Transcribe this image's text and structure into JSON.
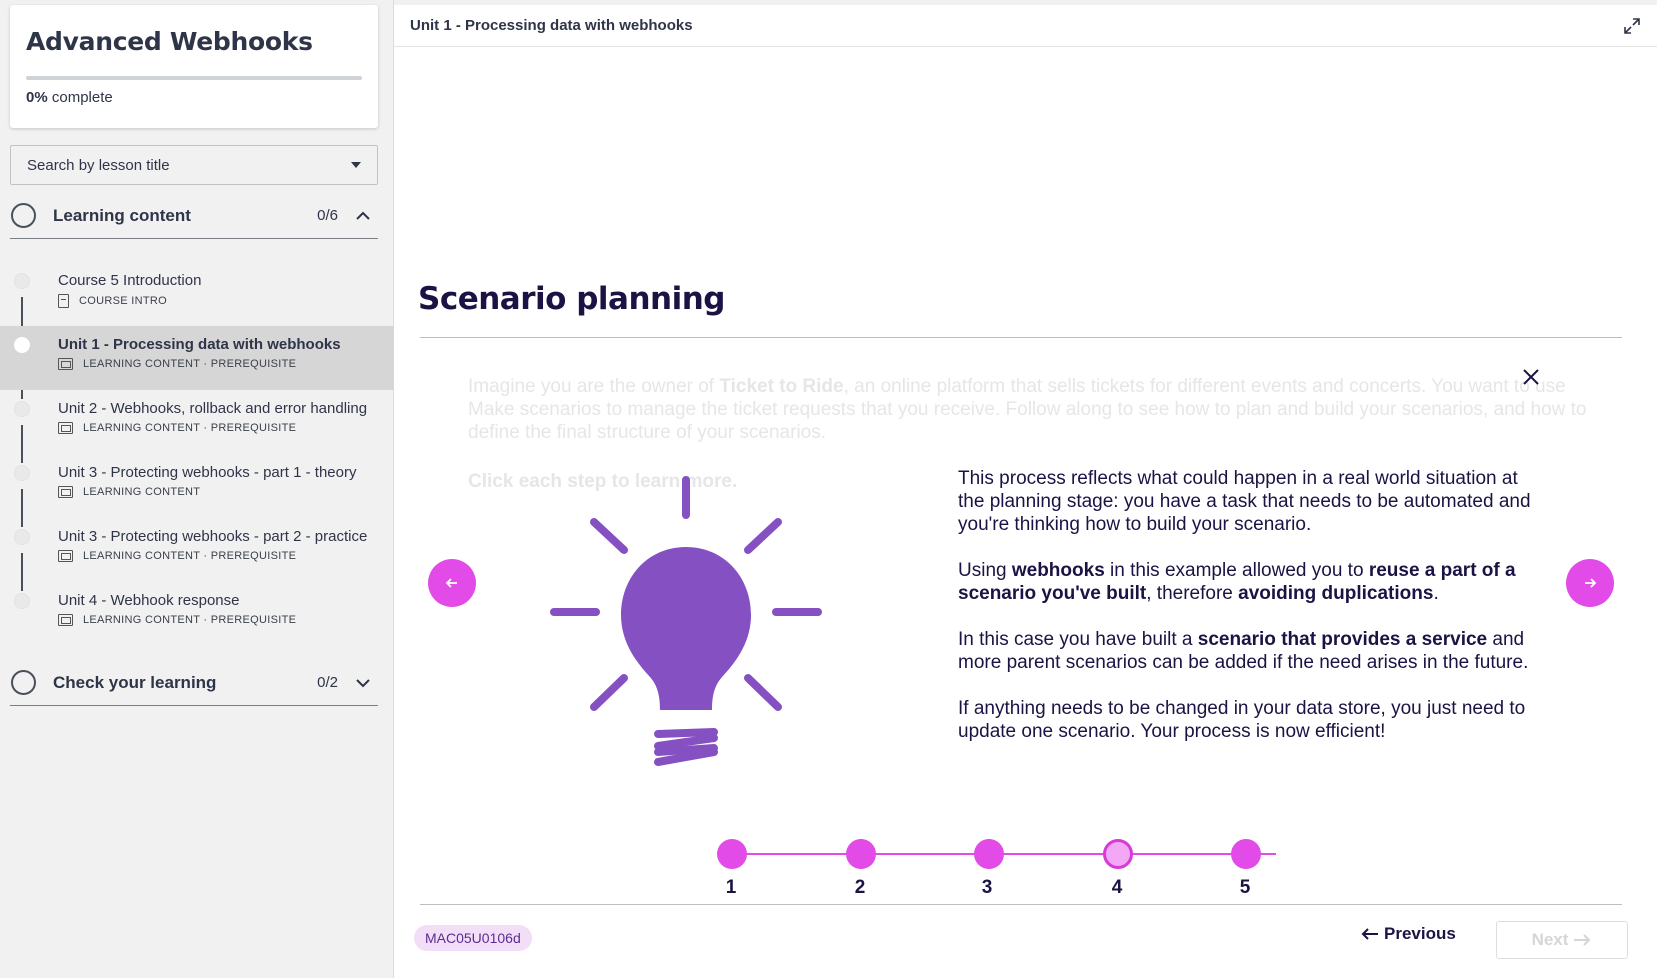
{
  "course": {
    "title": "Advanced Webhooks",
    "progress_percent_label": "0%",
    "progress_suffix": "complete",
    "progress": 0
  },
  "search": {
    "label": "Search by lesson title"
  },
  "sections": [
    {
      "title": "Learning content",
      "count": "0/6",
      "expanded": true
    },
    {
      "title": "Check your learning",
      "count": "0/2",
      "expanded": false
    }
  ],
  "lessons": [
    {
      "title": "Course 5 Introduction",
      "meta": "COURSE INTRO",
      "icon": "document-icon",
      "active": false
    },
    {
      "title": "Unit 1 - Processing data with webhooks",
      "meta": "LEARNING CONTENT · PREREQUISITE",
      "icon": "slides-icon",
      "active": true
    },
    {
      "title": "Unit 2 - Webhooks, rollback and error handling",
      "meta": "LEARNING CONTENT · PREREQUISITE",
      "icon": "slides-icon",
      "active": false
    },
    {
      "title": "Unit 3 - Protecting webhooks - part 1 - theory",
      "meta": "LEARNING CONTENT",
      "icon": "slides-icon",
      "active": false
    },
    {
      "title": "Unit 3 - Protecting webhooks - part 2 - practice",
      "meta": "LEARNING CONTENT · PREREQUISITE",
      "icon": "slides-icon",
      "active": false
    },
    {
      "title": "Unit 4 - Webhook response",
      "meta": "LEARNING CONTENT · PREREQUISITE",
      "icon": "slides-icon",
      "active": false
    }
  ],
  "main": {
    "topbar_title": "Unit 1 - Processing data with webhooks",
    "slide_title": "Scenario planning",
    "faded_intro_1": "Imagine you are the owner of ",
    "faded_intro_bold": "Ticket to Ride",
    "faded_intro_2": ", an online platform that sells tickets for different events and concerts. You want to use Make scenarios to manage the ticket requests that you receive. Follow along to see how to plan and build your scenarios, and how to define the final structure of your scenarios.",
    "faded_cta": "Click each step to learn more.",
    "desc": {
      "p1": "This process reflects what could happen in a real world situation at the planning stage: you have a task that needs to be automated and you're thinking how to build your scenario.",
      "p2_a": "Using ",
      "p2_b": "webhooks",
      "p2_c": " in this example allowed you to ",
      "p2_d": "reuse a part of a scenario you've built",
      "p2_e": ", therefore ",
      "p2_f": "avoiding duplications",
      "p2_g": ".",
      "p3_a": "In this case you have built a ",
      "p3_b": "scenario that provides a service",
      "p3_c": " and more parent scenarios can be added if the need arises in the future.",
      "p4": "If anything needs to be changed in your data store, you just need to update one scenario. Your process is now efficient!"
    },
    "steps": [
      "1",
      "2",
      "3",
      "4",
      "5"
    ],
    "current_step": 4,
    "code": "MAC05U0106d",
    "previous_label": "Previous",
    "next_label": "Next"
  },
  "colors": {
    "accent": "#e24be7",
    "bulb": "#8550c2",
    "heading": "#1d1244"
  }
}
